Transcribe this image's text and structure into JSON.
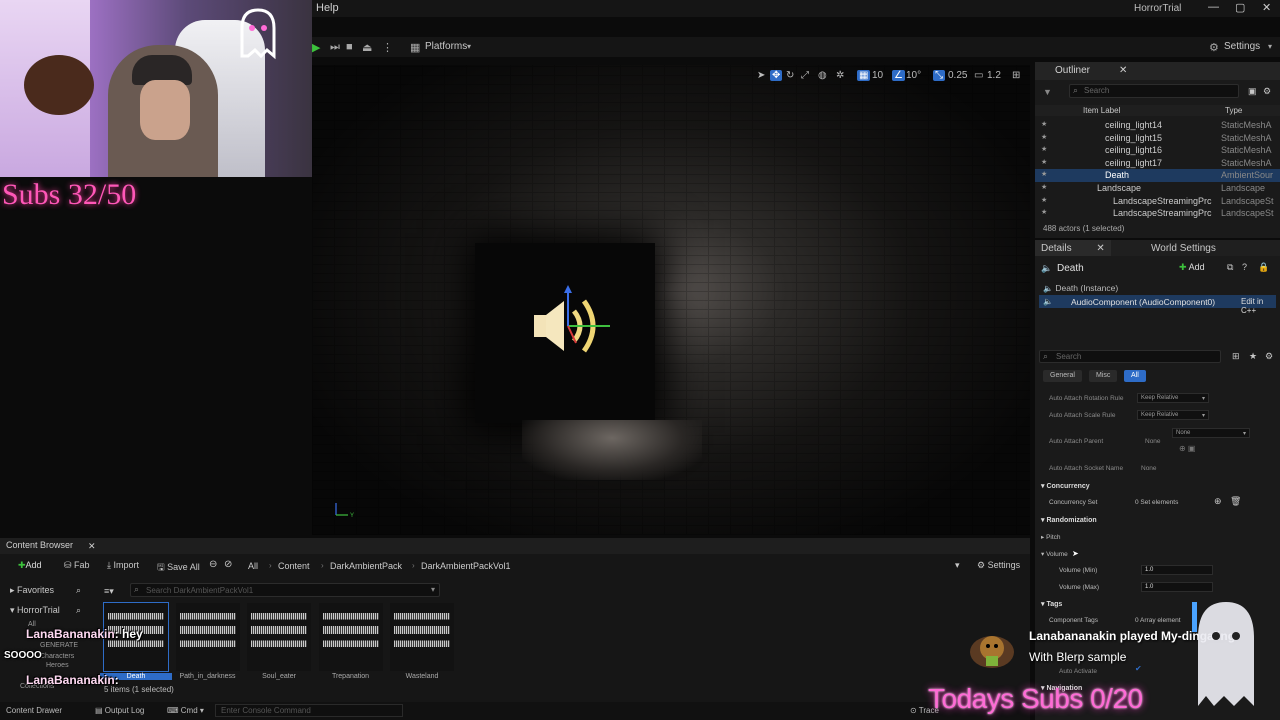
{
  "window": {
    "menu_help": "Help",
    "project_name": "HorrorTrial",
    "controls": [
      "—",
      "▢",
      "✕"
    ]
  },
  "toolbar": {
    "platforms_label": "Platforms",
    "settings_label": "Settings"
  },
  "viewport": {
    "grid_size": "10",
    "rotation_snap": "10°",
    "scale_snap": "0.25",
    "camera_speed": "1.2"
  },
  "outliner": {
    "tab": "Outliner",
    "search_placeholder": "Search",
    "col_label": "Item Label",
    "col_type": "Type",
    "rows": [
      {
        "label": "ceiling_light14",
        "type": "StaticMeshA"
      },
      {
        "label": "ceiling_light15",
        "type": "StaticMeshA"
      },
      {
        "label": "ceiling_light16",
        "type": "StaticMeshA"
      },
      {
        "label": "ceiling_light17",
        "type": "StaticMeshA"
      },
      {
        "label": "Death",
        "type": "AmbientSour"
      },
      {
        "label": "Landscape",
        "type": "Landscape"
      },
      {
        "label": "LandscapeStreamingPrc",
        "type": "LandscapeSt"
      },
      {
        "label": "LandscapeStreamingPrc",
        "type": "LandscapeSt"
      }
    ],
    "count": "488 actors (1 selected)"
  },
  "details": {
    "tab": "Details",
    "tab2": "World Settings",
    "actor_name": "Death",
    "add_label": "Add",
    "instance": "Death (Instance)",
    "component": "AudioComponent (AudioComponent0)",
    "edit_cpp": "Edit in C++",
    "search_placeholder": "Search",
    "filters": [
      "General",
      "Misc",
      "All"
    ],
    "props": {
      "rot_rule_label": "Auto Attach Rotation Rule",
      "rot_rule_value": "Keep Relative",
      "scale_rule_label": "Auto Attach Scale Rule",
      "scale_rule_value": "Keep Relative",
      "parent_label": "Auto Attach Parent",
      "parent_value": "None",
      "parent_dd": "None",
      "socket_label": "Auto Attach Socket Name",
      "socket_value": "None",
      "concurrency": "Concurrency",
      "concurrency_set": "Concurrency Set",
      "concurrency_value": "0 Set elements",
      "randomization": "Randomization",
      "pitch": "Pitch",
      "volume": "Volume",
      "volume_min_label": "Volume (Min)",
      "volume_min": "1.0",
      "volume_max_label": "Volume (Max)",
      "volume_max": "1.0",
      "tags": "Tags",
      "component_tags": "Component Tags",
      "component_tags_value": "0 Array element",
      "auto_activate": "Auto Activate",
      "navigation": "Navigation"
    }
  },
  "content_browser": {
    "tab": "Content Browser",
    "add": "Add",
    "fab": "Fab",
    "import": "Import",
    "save_all": "Save All",
    "settings": "Settings",
    "path": [
      "All",
      "Content",
      "DarkAmbientPack",
      "DarkAmbientPackVol1"
    ],
    "search_placeholder": "Search DarkAmbientPackVol1",
    "favorites": "Favorites",
    "project": "HorrorTrial",
    "tree": [
      "All",
      "GENERATE",
      "Characters",
      "Heroes"
    ],
    "collections": "Collections",
    "assets": [
      "Death",
      "Path_in_darkness",
      "Soul_eater",
      "Trepanation",
      "Wasteland"
    ],
    "items_count": "5 items (1 selected)"
  },
  "statusbar": {
    "content_drawer": "Content Drawer",
    "output_log": "Output Log",
    "cmd": "Cmd",
    "console_placeholder": "Enter Console Command",
    "trace": "Trace"
  },
  "overlay": {
    "subs_goal": "Subs 32/50",
    "chat_user": "LanaBananakin",
    "chat_msg_1": ": hey",
    "chat_soooo": "SOOOO",
    "chat_msg_2": ": ",
    "alert_line1": "Lanabananakin played My-dingaling",
    "alert_line2": "With Blerp sample",
    "todays_subs": "Todays Subs 0/20"
  }
}
